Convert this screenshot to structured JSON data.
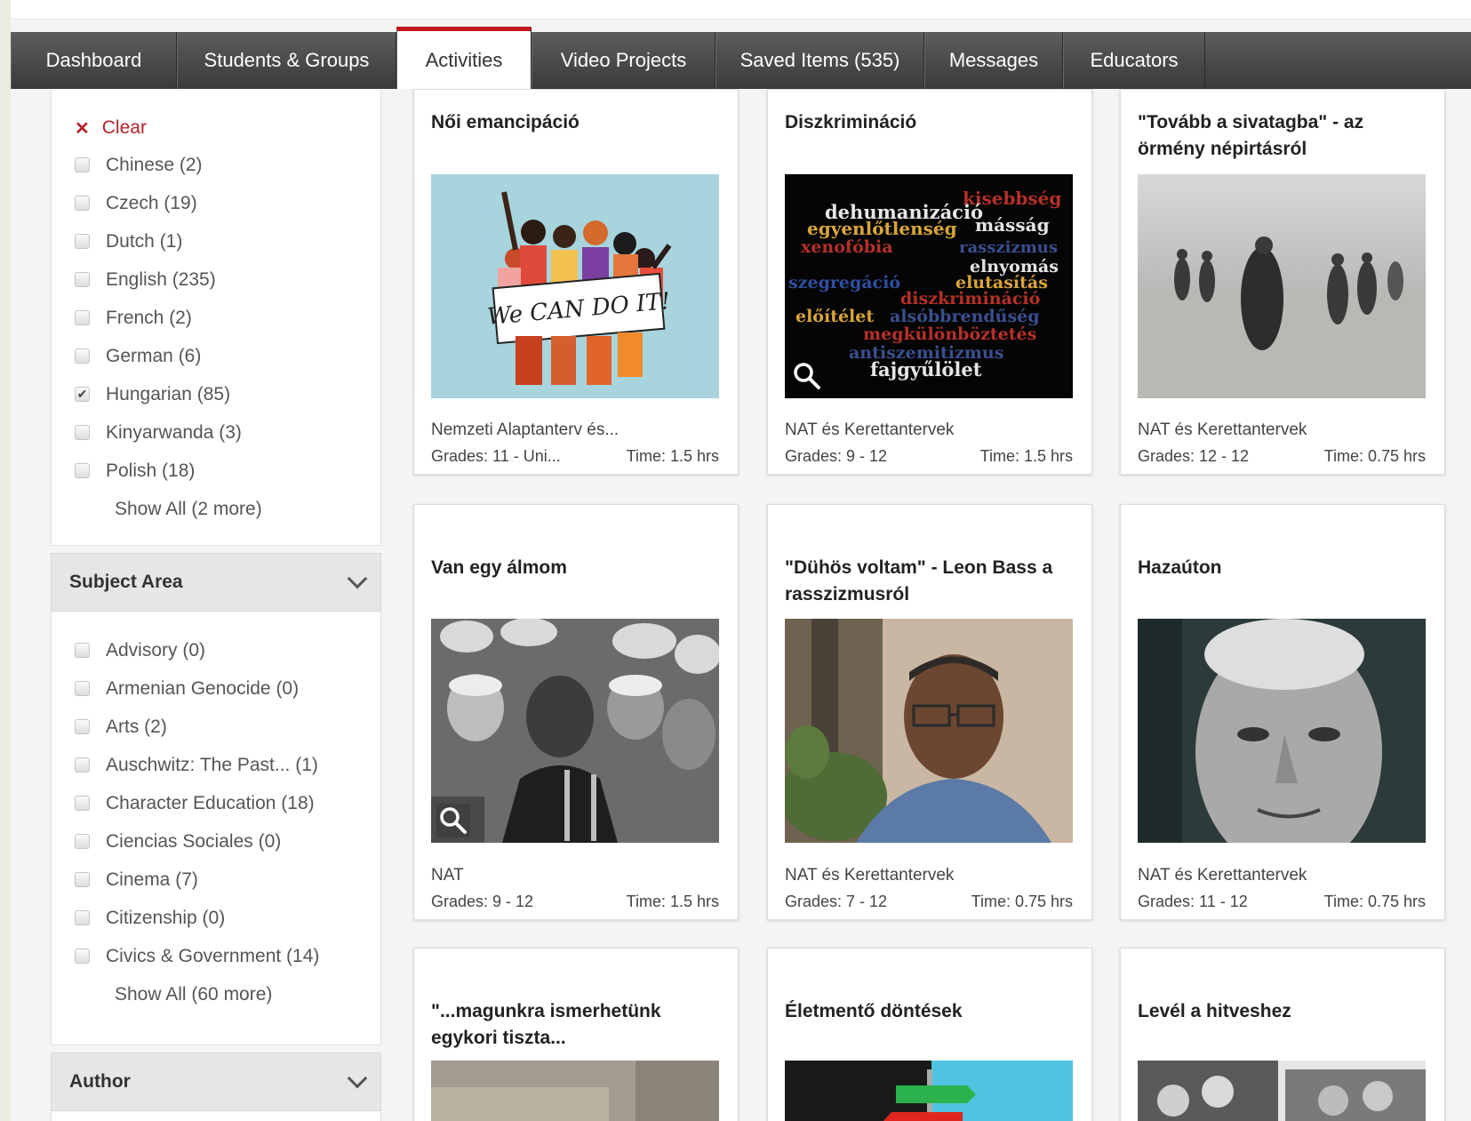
{
  "nav": {
    "tabs": [
      {
        "label": "Dashboard"
      },
      {
        "label": "Students & Groups"
      },
      {
        "label": "Activities"
      },
      {
        "label": "Video Projects"
      },
      {
        "label": "Saved Items (535)"
      },
      {
        "label": "Messages"
      },
      {
        "label": "Educators"
      }
    ],
    "active": "Activities"
  },
  "sidebar": {
    "clear_label": "Clear",
    "languages": [
      {
        "label": "Chinese (2)",
        "checked": false
      },
      {
        "label": "Czech (19)",
        "checked": false
      },
      {
        "label": "Dutch (1)",
        "checked": false
      },
      {
        "label": "English (235)",
        "checked": false
      },
      {
        "label": "French (2)",
        "checked": false
      },
      {
        "label": "German (6)",
        "checked": false
      },
      {
        "label": "Hungarian (85)",
        "checked": true
      },
      {
        "label": "Kinyarwanda (3)",
        "checked": false
      },
      {
        "label": "Polish (18)",
        "checked": false
      }
    ],
    "languages_show_all": "Show All (2 more)",
    "subject_area_heading": "Subject Area",
    "subjects": [
      {
        "label": "Advisory (0)"
      },
      {
        "label": "Armenian Genocide (0)"
      },
      {
        "label": "Arts (2)"
      },
      {
        "label": "Auschwitz: The Past... (1)"
      },
      {
        "label": "Character Education (18)"
      },
      {
        "label": "Ciencias Sociales (0)"
      },
      {
        "label": "Cinema (7)"
      },
      {
        "label": "Citizenship (0)"
      },
      {
        "label": "Civics & Government (14)"
      }
    ],
    "subjects_show_all": "Show All (60 more)",
    "author_heading": "Author"
  },
  "cards": [
    {
      "title": "Női emancipáció",
      "subtitle": "Nemzeti Alaptanterv és...",
      "grades": "Grades: 11 - Uni...",
      "time": "Time: 1.5 hrs",
      "image": "we-can-do-it-illustration",
      "poster_text": "We CAN DO IT!"
    },
    {
      "title": "Diszkrimináció",
      "subtitle": "NAT és Kerettantervek",
      "grades": "Grades: 9 - 12",
      "time": "Time: 1.5 hrs",
      "image": "word-cloud",
      "words": [
        "kisebbség",
        "dehumanizáció",
        "egyenlőtlenség",
        "másság",
        "xenofóbia",
        "rasszizmus",
        "elnyomás",
        "szegregáció",
        "elutasítás",
        "diszkrimináció",
        "előítélet",
        "alsóbbrendűség",
        "megkülönböztetés",
        "antiszemitizmus",
        "fajgyűlölet"
      ]
    },
    {
      "title": "\"Tovább a sivatagba\" - az örmény népirtásról",
      "subtitle": "NAT és Kerettantervek",
      "grades": "Grades: 12 - 12",
      "time": "Time: 0.75 hrs",
      "image": "desert-photo"
    },
    {
      "title": "Van egy álmom",
      "subtitle": "NAT",
      "grades": "Grades: 9 - 12",
      "time": "Time: 1.5 hrs",
      "image": "speech-photo"
    },
    {
      "title": "\"Dühös voltam\" - Leon Bass a rasszizmusról",
      "subtitle": "NAT és Kerettantervek",
      "grades": "Grades: 7 - 12",
      "time": "Time: 0.75 hrs",
      "image": "interview-photo"
    },
    {
      "title": "Hazaúton",
      "subtitle": "NAT és Kerettantervek",
      "grades": "Grades: 11 - 12",
      "time": "Time: 0.75 hrs",
      "image": "portrait-photo"
    },
    {
      "title": "\"...magunkra ismerhetünk egykori tiszta...",
      "image": "street-photo"
    },
    {
      "title": "Életmentő döntések",
      "image": "signpost-illustration"
    },
    {
      "title": "Levél a hitveshez",
      "image": "couple-photo"
    }
  ],
  "colors": {
    "accent": "#c4151c",
    "nav_bg": "#484848"
  }
}
